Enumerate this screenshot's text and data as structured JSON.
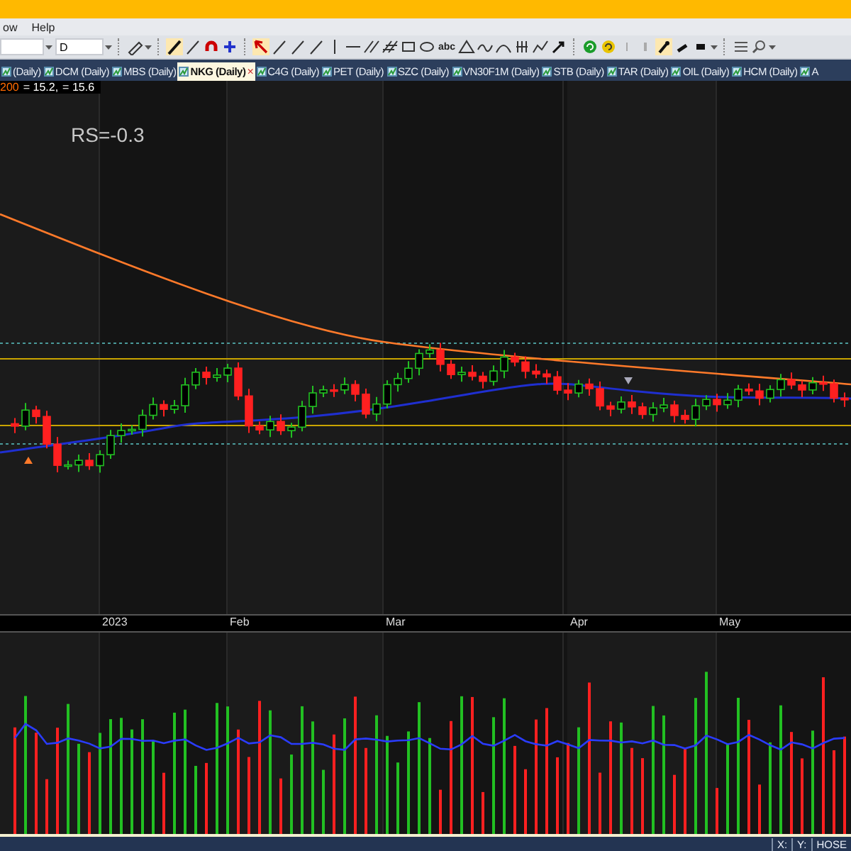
{
  "menu": {
    "items": [
      "ow",
      "Help"
    ]
  },
  "toolbar": {
    "interval_field": {
      "value": "D"
    },
    "text_tool_label": "abc"
  },
  "tabs": [
    {
      "label": "(Daily)",
      "selected": false
    },
    {
      "label": "DCM (Daily)",
      "selected": false
    },
    {
      "label": "MBS (Daily)",
      "selected": false
    },
    {
      "label": "NKG (Daily)",
      "selected": true,
      "close": "×"
    },
    {
      "label": "C4G (Daily)",
      "selected": false
    },
    {
      "label": "PET (Daily)",
      "selected": false
    },
    {
      "label": "SZC (Daily)",
      "selected": false
    },
    {
      "label": "VN30F1M (Daily)",
      "selected": false
    },
    {
      "label": "STB (Daily)",
      "selected": false
    },
    {
      "label": "TAR (Daily)",
      "selected": false
    },
    {
      "label": "OIL (Daily)",
      "selected": false
    },
    {
      "label": "HCM (Daily)",
      "selected": false
    },
    {
      "label": "A",
      "selected": false
    }
  ],
  "chart": {
    "legend": [
      {
        "text": "200",
        "color": "#ff6a00"
      },
      {
        "text": "= 15.2,",
        "color": "#ffffff"
      },
      {
        "text": "= 15.6",
        "color": "#ffffff"
      }
    ],
    "annotation": "RS=-0.3",
    "x_axis_labels": [
      "2023",
      "Feb",
      "Mar",
      "Apr",
      "May"
    ]
  },
  "status_bar": {
    "items": [
      "X:",
      "Y:",
      "HOSE"
    ]
  }
}
